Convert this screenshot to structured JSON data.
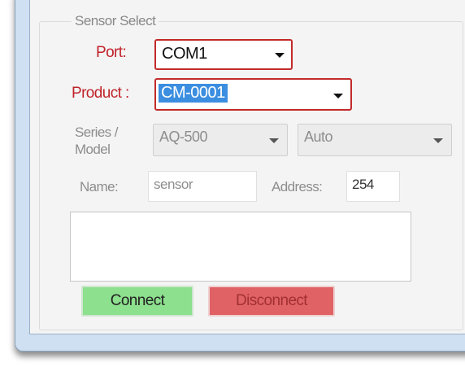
{
  "group": {
    "title": "Sensor Select"
  },
  "port": {
    "label": "Port:",
    "value": "COM1"
  },
  "product": {
    "label": "Product :",
    "value": "CM-0001"
  },
  "series": {
    "label_line1": "Series /",
    "label_line2": "Model",
    "model_value": "AQ-500",
    "mode_value": "Auto"
  },
  "name": {
    "label": "Name:",
    "value": "sensor"
  },
  "address": {
    "label": "Address:",
    "value": "254"
  },
  "buttons": {
    "connect": "Connect",
    "disconnect": "Disconnect"
  },
  "colors": {
    "error_border": "#c22a2a",
    "connect_bg": "#8de08e",
    "disconnect_bg": "#e06265",
    "selection": "#3b8ee0"
  },
  "icons": {
    "dropdown": "chevron-down-icon"
  }
}
